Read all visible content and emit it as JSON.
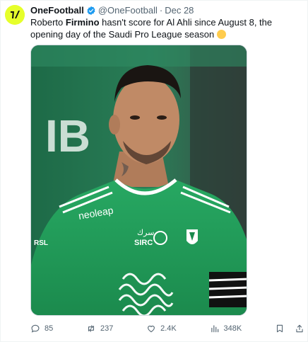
{
  "tweet": {
    "author_name": "OneFootball",
    "handle": "@OneFootball",
    "separator": "·",
    "date": "Dec 28",
    "text_before": "Roberto ",
    "text_bold": "Firmino",
    "text_after": " hasn't score for Al Ahli since August 8, the opening day of the Saudi Pro League season "
  },
  "media": {
    "bg_letters": "IB",
    "sponsor": "neoleap",
    "sponsor2_arabic": "سرك",
    "sponsor2_latin": "SIRC"
  },
  "actions": {
    "replies": "85",
    "retweets": "237",
    "likes": "2.4K",
    "views": "348K"
  },
  "colors": {
    "brand_avatar": "#e6ff2b",
    "verified": "#1d9bf0",
    "muted_text": "#536471",
    "jersey_green": "#1f9a55"
  },
  "icons": [
    "onefootball-logo",
    "verified-badge",
    "reply-icon",
    "retweet-icon",
    "like-icon",
    "views-icon",
    "bookmark-icon",
    "share-icon"
  ]
}
